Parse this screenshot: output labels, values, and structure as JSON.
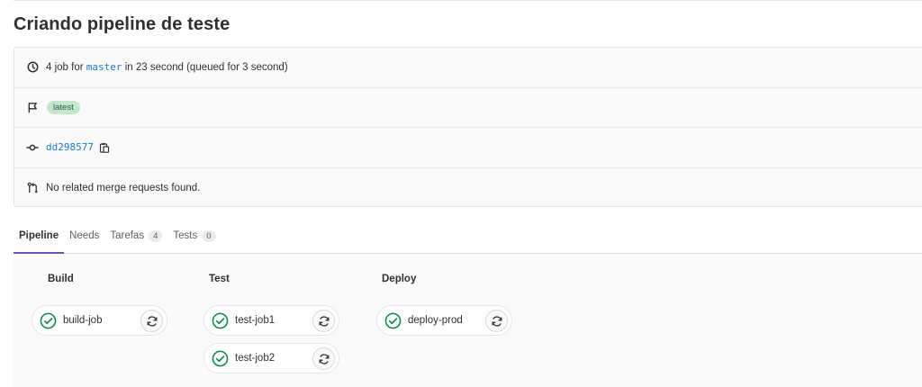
{
  "page": {
    "title": "Criando pipeline de teste"
  },
  "info": {
    "jobs_prefix": "4 job for ",
    "branch": "master",
    "duration_text": " in 23 second (queued for 3 second)",
    "badge_latest": "latest",
    "commit_sha": "dd298577",
    "merge_requests": "No related merge requests found."
  },
  "tabs": [
    {
      "label": "Pipeline",
      "count": null,
      "active": true
    },
    {
      "label": "Needs",
      "count": null,
      "active": false
    },
    {
      "label": "Tarefas",
      "count": "4",
      "active": false
    },
    {
      "label": "Tests",
      "count": "0",
      "active": false
    }
  ],
  "stages": [
    {
      "name": "Build",
      "jobs": [
        {
          "name": "build-job",
          "status": "passed"
        }
      ]
    },
    {
      "name": "Test",
      "jobs": [
        {
          "name": "test-job1",
          "status": "passed"
        },
        {
          "name": "test-job2",
          "status": "passed"
        }
      ]
    },
    {
      "name": "Deploy",
      "jobs": [
        {
          "name": "deploy-prod",
          "status": "passed"
        }
      ]
    }
  ],
  "icons": {
    "duration": "clock-icon",
    "flag": "flag-icon",
    "commit": "commit-icon",
    "copy": "clipboard-icon",
    "merge_request": "merge-request-icon",
    "job_status": "status-success-icon",
    "retry": "retry-icon"
  },
  "colors": {
    "link": "#1f78d1",
    "success": "#108548",
    "badge_bg": "#c3e6cd",
    "tab_active": "#6b4fbb"
  }
}
